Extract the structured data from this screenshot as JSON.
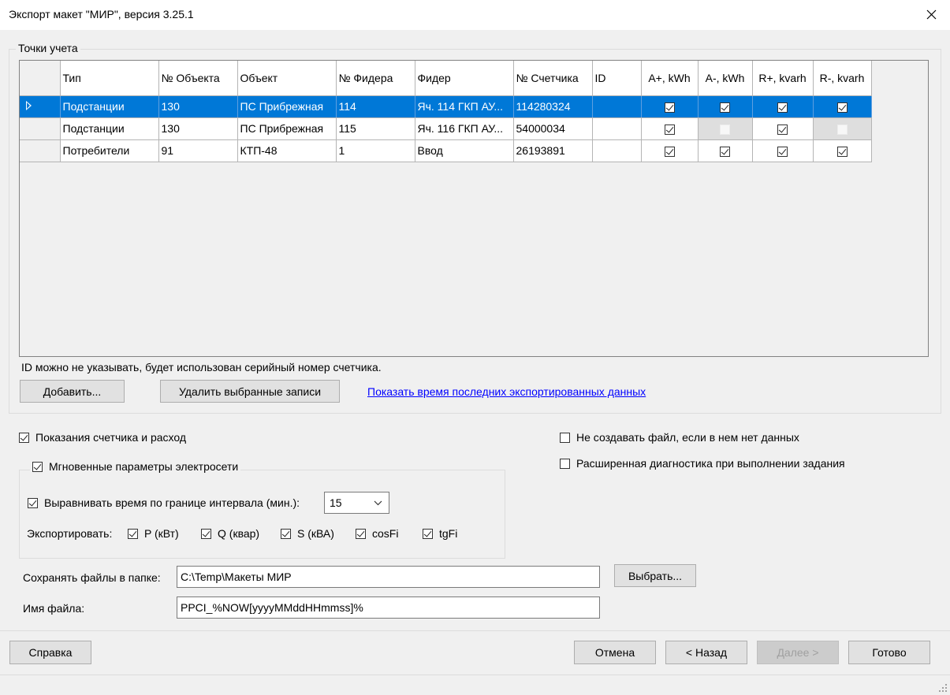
{
  "window": {
    "title": "Экспорт макет \"МИР\", версия 3.25.1"
  },
  "points_group": {
    "title": "Точки учета",
    "columns": [
      "Тип",
      "№ Объекта",
      "Объект",
      "№ Фидера",
      "Фидер",
      "№ Счетчика",
      "ID",
      "A+, kWh",
      "A-, kWh",
      "R+, kvarh",
      "R-, kvarh"
    ],
    "rows": [
      {
        "type": "Подстанции",
        "object_no": "130",
        "object": "ПС Прибрежная",
        "feeder_no": "114",
        "feeder": "Яч. 114 ГКП АУ...",
        "meter_no": "114280324",
        "id": "",
        "a_plus": true,
        "a_minus": true,
        "r_plus": true,
        "r_minus": true,
        "selected": true
      },
      {
        "type": "Подстанции",
        "object_no": "130",
        "object": "ПС Прибрежная",
        "feeder_no": "115",
        "feeder": "Яч. 116 ГКП АУ...",
        "meter_no": "54000034",
        "id": "",
        "a_plus": true,
        "a_minus": false,
        "r_plus": true,
        "r_minus": false,
        "selected": false
      },
      {
        "type": "Потребители",
        "object_no": "91",
        "object": "КТП-48",
        "feeder_no": "1",
        "feeder": "Ввод",
        "meter_no": "26193891",
        "id": "",
        "a_plus": true,
        "a_minus": true,
        "r_plus": true,
        "r_minus": true,
        "selected": false
      }
    ],
    "hint": "ID можно не указывать, будет использован серийный номер счетчика.",
    "add_label": "Добавить...",
    "delete_label": "Удалить выбранные записи",
    "show_time_link": "Показать время последних экспортированных данных"
  },
  "options": {
    "meter_readings": {
      "label": "Показания счетчика и расход",
      "checked": true
    },
    "no_empty_file": {
      "label": "Не создавать файл, если в нем нет данных",
      "checked": false
    },
    "extended_diag": {
      "label": "Расширенная диагностика при выполнении задания",
      "checked": false
    },
    "instant_params": {
      "label": "Мгновенные параметры электросети",
      "checked": true
    },
    "align_time": {
      "label": "Выравнивать время по границе интервала (мин.):",
      "checked": true
    },
    "interval_value": "15",
    "export_label": "Экспортировать:",
    "export_items": [
      {
        "label": "P (кВт)",
        "checked": true
      },
      {
        "label": "Q (квар)",
        "checked": true
      },
      {
        "label": "S (кВА)",
        "checked": true
      },
      {
        "label": "cosFi",
        "checked": true
      },
      {
        "label": "tgFi",
        "checked": true
      }
    ]
  },
  "save": {
    "folder_label": "Сохранять файлы в папке:",
    "folder_value": "C:\\Temp\\Макеты МИР",
    "browse_label": "Выбрать...",
    "filename_label": "Имя файла:",
    "filename_value": "PPCI_%NOW[yyyyMMddHHmmss]%"
  },
  "footer": {
    "help": "Справка",
    "cancel": "Отмена",
    "back": "< Назад",
    "next": "Далее >",
    "finish": "Готово"
  }
}
